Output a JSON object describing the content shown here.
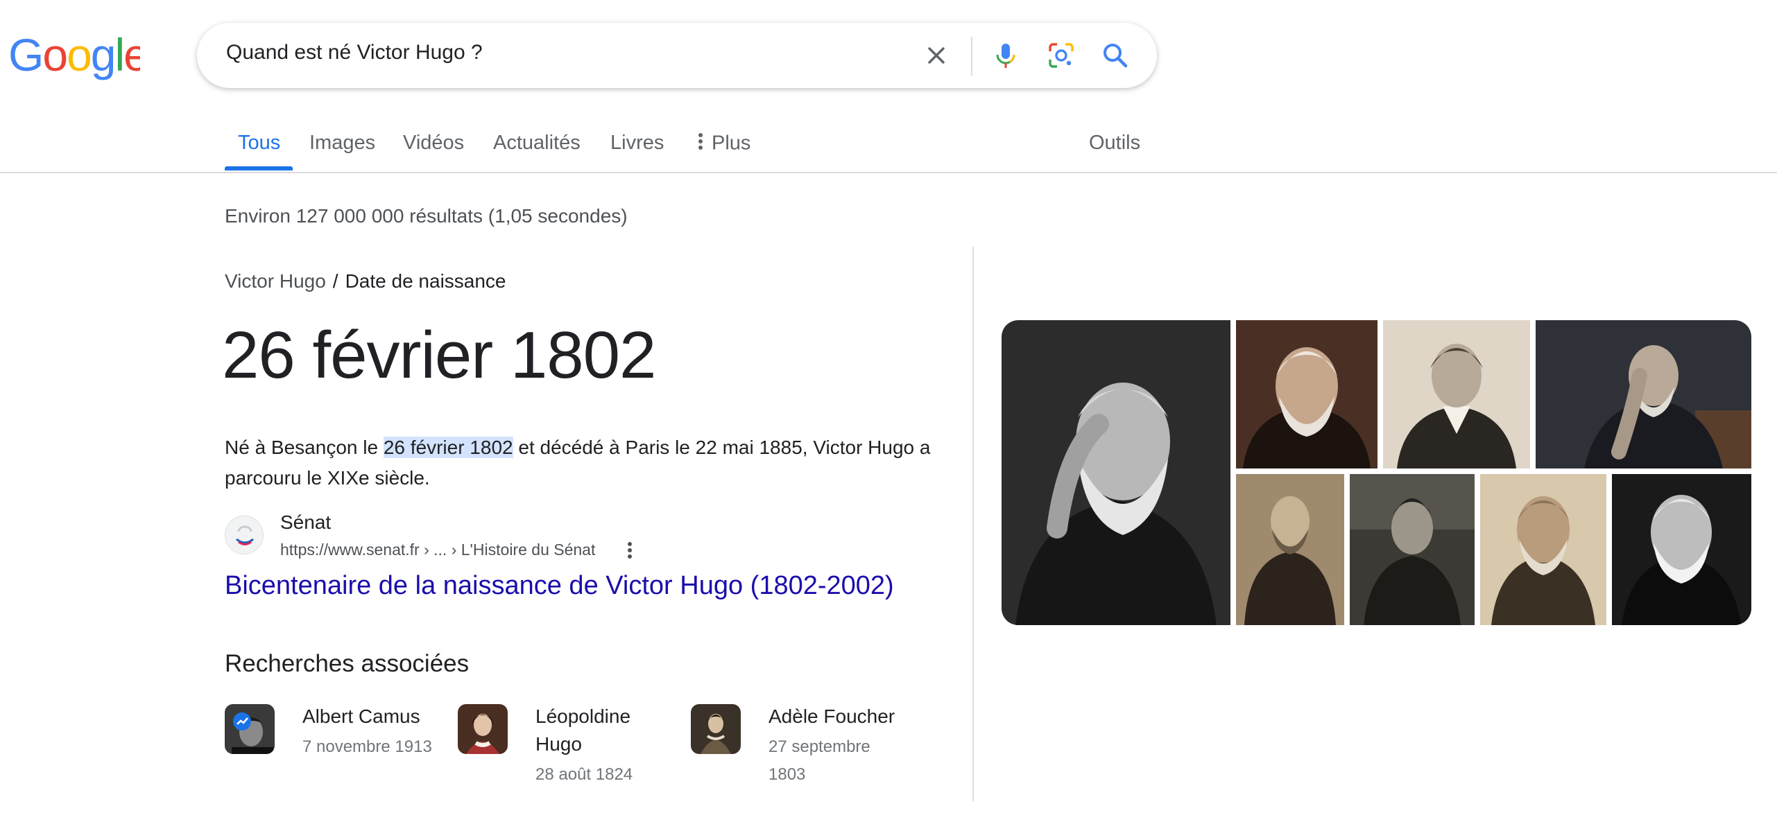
{
  "logo": {
    "text": "Google"
  },
  "search": {
    "query": "Quand est né Victor Hugo ?"
  },
  "tabs": [
    {
      "label": "Tous",
      "active": true
    },
    {
      "label": "Images"
    },
    {
      "label": "Vidéos"
    },
    {
      "label": "Actualités"
    },
    {
      "label": "Livres"
    },
    {
      "label": "Plus"
    },
    {
      "label": "Outils"
    }
  ],
  "stats": "Environ 127 000 000 résultats (1,05 secondes)",
  "featured": {
    "breadcrumb_link": "Victor Hugo",
    "breadcrumb_sep": "/",
    "breadcrumb_current": "Date de naissance",
    "answer": "26 février 1802",
    "snippet_before": "Né à Besançon le ",
    "snippet_highlight": "26 février 1802",
    "snippet_after": " et décédé à Paris le 22 mai 1885, Victor Hugo a parcouru le XIXe siècle."
  },
  "source": {
    "name": "Sénat",
    "url": "https://www.senat.fr › ... › L'Histoire du Sénat",
    "title": "Bicentenaire de la naissance de Victor Hugo (1802-2002)"
  },
  "related": {
    "title": "Recherches associées",
    "items": [
      {
        "name": "Albert Camus",
        "date": "7 novembre 1913"
      },
      {
        "name": "Léopoldine Hugo",
        "date": "28 août 1824"
      },
      {
        "name": "Adèle Foucher",
        "date": "27 septembre 1803"
      }
    ]
  },
  "colors": {
    "accent": "#1a73e8",
    "link": "#1a0dab",
    "highlight": "#d3e3fd"
  },
  "icons": [
    "clear-icon",
    "microphone-icon",
    "lens-icon",
    "search-icon",
    "more-vert-icon"
  ]
}
